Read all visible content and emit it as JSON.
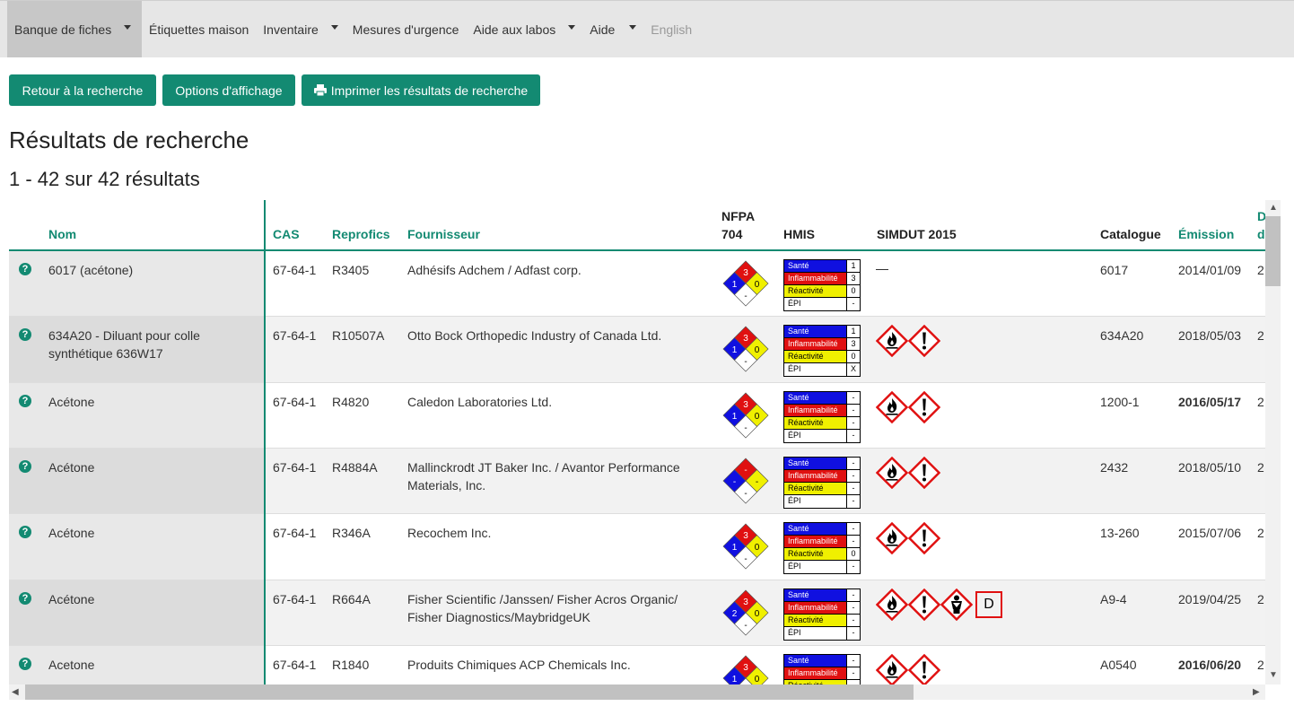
{
  "nav": {
    "items": [
      {
        "label": "Banque de fiches",
        "dropdown": true,
        "active": true
      },
      {
        "label": "Étiquettes maison",
        "dropdown": false
      },
      {
        "label": "Inventaire",
        "dropdown": true
      },
      {
        "label": "Mesures d'urgence",
        "dropdown": false
      },
      {
        "label": "Aide aux labos",
        "dropdown": true
      },
      {
        "label": "Aide",
        "dropdown": true
      },
      {
        "label": "English",
        "dropdown": false,
        "disabled": true
      }
    ]
  },
  "toolbar": {
    "back_label": "Retour à la recherche",
    "display_label": "Options d'affichage",
    "print_label": "Imprimer les résultats de recherche"
  },
  "page": {
    "title": "Résultats de recherche",
    "count": "1 - 42 sur 42 résultats"
  },
  "table": {
    "headers": {
      "name": "Nom",
      "cas": "CAS",
      "reprofics": "Reprofics",
      "supplier": "Fournisseur",
      "nfpa_1": "NFPA",
      "nfpa_2": "704",
      "hmis": "HMIS",
      "simdut": "SIMDUT 2015",
      "catalog": "Catalogue",
      "emission": "Émission",
      "next_1": "D",
      "next_2": "d"
    },
    "hmis_labels": [
      "Santé",
      "Inflammabilité",
      "Réactivité",
      "ÉPI"
    ],
    "help_glyph": "?",
    "rows": [
      {
        "name": "6017 (acétone)",
        "cas": "67-64-1",
        "reprofics": "R3405",
        "supplier": "Adhésifs Adchem / Adfast corp.",
        "nfpa": {
          "health": "1",
          "fire": "3",
          "reactivity": "0",
          "special": "-"
        },
        "hmis": [
          "1",
          "3",
          "0",
          "-"
        ],
        "simdut": [],
        "simdut_none": "—",
        "catalog": "6017",
        "emission": "2014/01/09",
        "emission_bold": false,
        "next": "2"
      },
      {
        "name": "634A20 - Diluant pour colle synthétique 636W17",
        "cas": "67-64-1",
        "reprofics": "R10507A",
        "supplier": "Otto Bock Orthopedic Industry of Canada Ltd.",
        "nfpa": {
          "health": "1",
          "fire": "3",
          "reactivity": "0",
          "special": "-"
        },
        "hmis": [
          "1",
          "3",
          "0",
          "X"
        ],
        "simdut": [
          "flame-icon",
          "exclamation-icon"
        ],
        "catalog": "634A20",
        "emission": "2018/05/03",
        "emission_bold": false,
        "next": "2"
      },
      {
        "name": "Acétone",
        "cas": "67-64-1",
        "reprofics": "R4820",
        "supplier": "Caledon Laboratories Ltd.",
        "nfpa": {
          "health": "1",
          "fire": "3",
          "reactivity": "0",
          "special": "-"
        },
        "hmis": [
          "-",
          "-",
          "-",
          "-"
        ],
        "simdut": [
          "flame-icon",
          "exclamation-icon"
        ],
        "catalog": "1200-1",
        "emission": "2016/05/17",
        "emission_bold": true,
        "next": "2"
      },
      {
        "name": "Acétone",
        "cas": "67-64-1",
        "reprofics": "R4884A",
        "supplier": "Mallinckrodt JT Baker Inc. / Avantor Performance Materials, Inc.",
        "nfpa": {
          "health": "-",
          "fire": "-",
          "reactivity": "-",
          "special": "-"
        },
        "hmis": [
          "-",
          "-",
          "-",
          "-"
        ],
        "simdut": [
          "flame-icon",
          "exclamation-icon"
        ],
        "catalog": "2432",
        "emission": "2018/05/10",
        "emission_bold": false,
        "next": "2"
      },
      {
        "name": "Acétone",
        "cas": "67-64-1",
        "reprofics": "R346A",
        "supplier": "Recochem Inc.",
        "nfpa": {
          "health": "1",
          "fire": "3",
          "reactivity": "0",
          "special": "-"
        },
        "hmis": [
          "-",
          "-",
          "0",
          "-"
        ],
        "simdut": [
          "flame-icon",
          "exclamation-icon"
        ],
        "catalog": "13-260",
        "emission": "2015/07/06",
        "emission_bold": false,
        "next": "2"
      },
      {
        "name": "Acétone",
        "cas": "67-64-1",
        "reprofics": "R664A",
        "supplier": "Fisher Scientific /Janssen/ Fisher Acros Organic/ Fisher Diagnostics/MaybridgeUK",
        "nfpa": {
          "health": "2",
          "fire": "3",
          "reactivity": "0",
          "special": "-"
        },
        "hmis": [
          "-",
          "-",
          "-",
          "-"
        ],
        "simdut": [
          "flame-icon",
          "exclamation-icon",
          "health-hazard-icon",
          "D"
        ],
        "catalog": "A9-4",
        "emission": "2019/04/25",
        "emission_bold": false,
        "next": "2"
      },
      {
        "name": "Acetone",
        "cas": "67-64-1",
        "reprofics": "R1840",
        "supplier": "Produits Chimiques ACP Chemicals Inc.",
        "nfpa": {
          "health": "1",
          "fire": "3",
          "reactivity": "0",
          "special": "-"
        },
        "hmis": [
          "-",
          "-",
          "-",
          "-"
        ],
        "simdut": [
          "flame-icon",
          "exclamation-icon"
        ],
        "catalog": "A0540",
        "emission": "2016/06/20",
        "emission_bold": true,
        "next": "2"
      }
    ]
  },
  "colors": {
    "accent": "#138a72",
    "nfpa_blue": "#1010e0",
    "nfpa_red": "#e01010",
    "nfpa_yellow": "#f0f000",
    "ghs_red": "#e01010"
  }
}
